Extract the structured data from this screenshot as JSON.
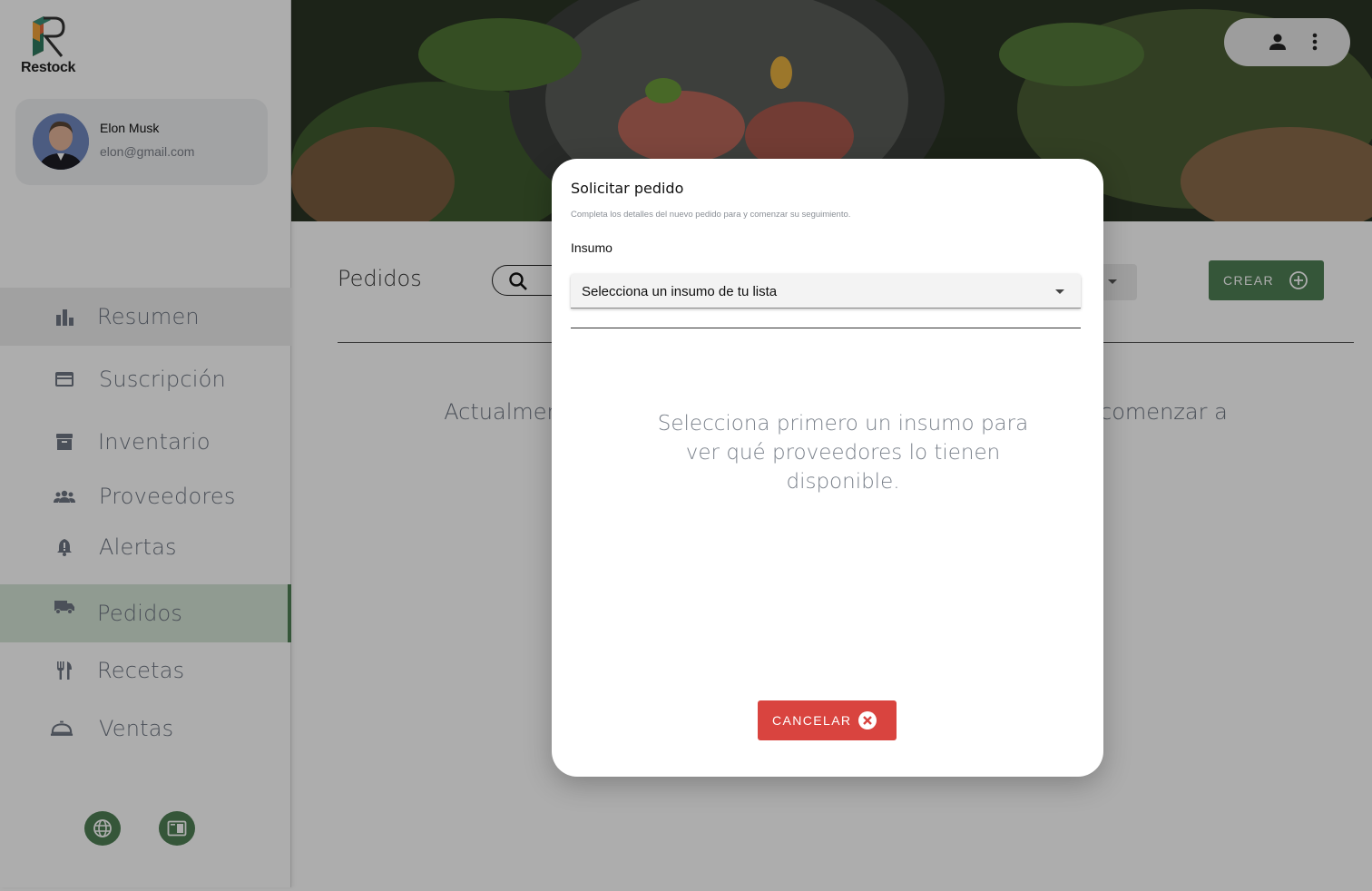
{
  "app": {
    "name": "Restock"
  },
  "user": {
    "name": "Elon Musk",
    "email": "elon@gmail.com"
  },
  "sidebar": {
    "items": [
      {
        "label": "Resumen",
        "icon": "bar-chart-icon"
      },
      {
        "label": "Suscripción",
        "icon": "credit-card-icon"
      },
      {
        "label": "Inventario",
        "icon": "archive-icon"
      },
      {
        "label": "Proveedores",
        "icon": "people-icon"
      },
      {
        "label": "Alertas",
        "icon": "bell-icon"
      },
      {
        "label": "Pedidos",
        "icon": "truck-icon"
      },
      {
        "label": "Recetas",
        "icon": "fork-knife-icon"
      },
      {
        "label": "Ventas",
        "icon": "service-bell-icon"
      }
    ],
    "active": "Pedidos"
  },
  "main": {
    "title": "Pedidos",
    "create_label": "CREAR",
    "empty_message": "Actualmente no tienes pedidos. Crea tu primer pedido para comenzar a ver el seguimiento en esta sección."
  },
  "modal": {
    "title": "Solicitar pedido",
    "subtitle": "Completa los detalles del nuevo pedido para y comenzar su seguimiento.",
    "field_label": "Insumo",
    "select_value": "Selecciona un insumo de tu lista",
    "info": "Selecciona primero un insumo para ver qué proveedores lo tienen disponible.",
    "cancel_label": "CANCELAR"
  },
  "colors": {
    "primary": "#4e7f55",
    "danger": "#d9443f",
    "active_bg": "#d5e5d6"
  }
}
